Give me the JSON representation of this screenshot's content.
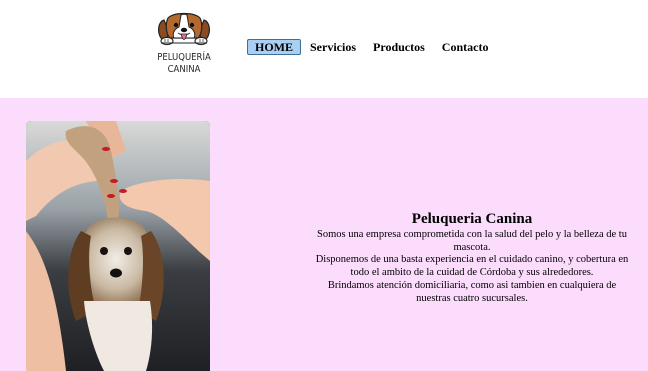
{
  "header": {
    "logo": {
      "line1": "PELUQUERÍA",
      "line2": "CANINA",
      "icon": "dog-face-icon"
    },
    "nav": [
      {
        "label": "HOME",
        "active": true
      },
      {
        "label": "Servicios",
        "active": false
      },
      {
        "label": "Productos",
        "active": false
      },
      {
        "label": "Contacto",
        "active": false
      }
    ]
  },
  "hero": {
    "image": "groomer-brushing-yorkshire-terrier-photo",
    "title": "Peluqueria Canina",
    "paragraphs": [
      "Somos una empresa comprometida con la salud del pelo y la belleza de tu mascota.",
      "Disponemos de una basta experiencia en el cuidado canino, y cobertura en todo el ambito de la cuidad de Córdoba y sus alrededores.",
      "Brindamos atención domiciliaria, como asi tambien en cualquiera de nuestras cuatro sucursales."
    ]
  },
  "colors": {
    "main_background": "#fcdcfc",
    "active_nav_background": "#a9cff2",
    "active_nav_border": "#3d6f9c"
  }
}
